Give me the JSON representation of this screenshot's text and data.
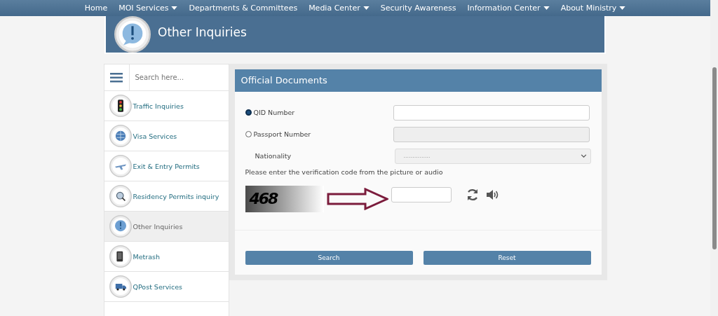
{
  "nav": [
    {
      "label": "Home",
      "dropdown": false
    },
    {
      "label": "MOI Services",
      "dropdown": true
    },
    {
      "label": "Departments & Committees",
      "dropdown": false
    },
    {
      "label": "Media Center",
      "dropdown": true
    },
    {
      "label": "Security Awareness",
      "dropdown": false
    },
    {
      "label": "Information Center",
      "dropdown": true
    },
    {
      "label": "About Ministry",
      "dropdown": true
    }
  ],
  "banner": {
    "title": "Other Inquiries"
  },
  "sidebar": {
    "search": {
      "placeholder": "Search here..."
    },
    "items": [
      {
        "label": "Traffic Inquiries",
        "kind": "traffic",
        "selected": false
      },
      {
        "label": "Visa Services",
        "kind": "globe",
        "selected": false
      },
      {
        "label": "Exit & Entry Permits",
        "kind": "plane",
        "selected": false
      },
      {
        "label": "Residency Permits inquiry",
        "kind": "magnifier",
        "selected": false
      },
      {
        "label": "Other Inquiries",
        "kind": "alert",
        "selected": true
      },
      {
        "label": "Metrash",
        "kind": "phone",
        "selected": false
      },
      {
        "label": "QPost Services",
        "kind": "truck",
        "selected": false
      }
    ]
  },
  "form": {
    "title": "Official Documents",
    "options": [
      {
        "label": "QID Number",
        "selected": true
      },
      {
        "label": "Passport Number",
        "selected": false
      }
    ],
    "nationality": {
      "label": "Nationality",
      "value": "..............."
    },
    "captcha_prompt": "Please enter the verification code from the picture or audio",
    "captcha_code": "468",
    "buttons": [
      "Search",
      "Reset"
    ]
  }
}
